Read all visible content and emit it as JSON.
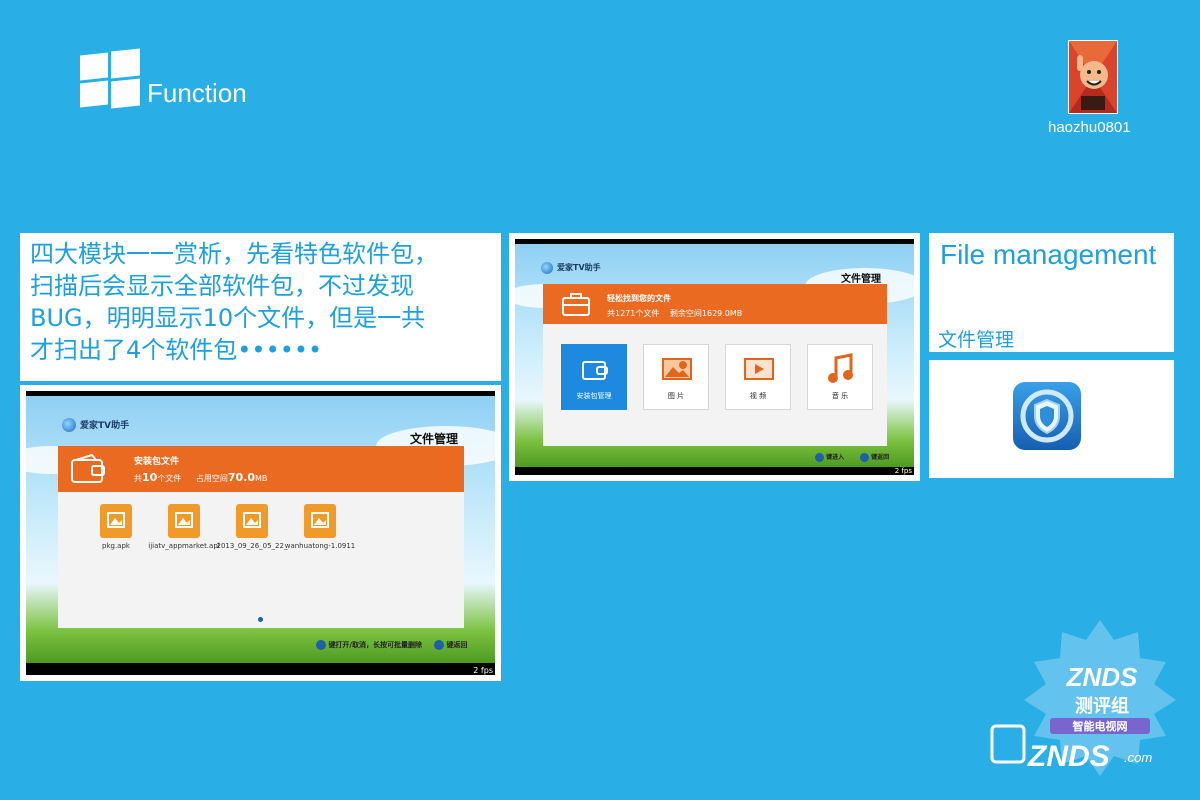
{
  "header": {
    "title": "Function",
    "user": "haozhu0801"
  },
  "description": {
    "lines": [
      "四大模块一一赏析，先看特色软件包，",
      "扫描后会显示全部软件包，不过发现",
      "BUG，明明显示10个文件，但是一共",
      "才扫出了4个软件包••••••"
    ]
  },
  "shot_home": {
    "app_name": "爱家TV助手",
    "page_title": "文件管理",
    "banner_title": "轻松找到您的文件",
    "total_label": "共1271个文件",
    "free_label": "剩余空间1629.0MB",
    "tiles": [
      {
        "label": "安装包管理",
        "icon": "wallet-icon"
      },
      {
        "label": "图 片",
        "icon": "picture-icon"
      },
      {
        "label": "视 频",
        "icon": "video-icon"
      },
      {
        "label": "音 乐",
        "icon": "music-icon"
      }
    ],
    "hint_ok": "键进入",
    "hint_back": "键返回",
    "fps": "2 fps"
  },
  "shot_apk": {
    "app_name": "爱家TV助手",
    "page_title": "文件管理",
    "banner_title": "安装包文件",
    "count_prefix": "共",
    "count_num": "10",
    "count_suffix": "个文件",
    "used_prefix": "占用空间",
    "used_num": "70.0",
    "used_unit": "MB",
    "files": [
      "pkg.apk",
      "ijiatv_appmarket.apl",
      "2013_09_26_05_22_",
      "wanhuatong-1.0911"
    ],
    "hint_ok": "键打开/取消，长按可批量删除",
    "hint_back": "键返回",
    "fps": "2 fps"
  },
  "file_mgmt": {
    "title": "File management",
    "subtitle": "文件管理"
  },
  "watermark": {
    "line1": "ZNDS",
    "line2": "测评组",
    "line3": "智能电视网",
    "site": "ZNDS",
    "domain": ".com"
  },
  "colors": {
    "background": "#29aee6",
    "accent_blue": "#1da0dc",
    "banner_orange": "#ea6a22"
  }
}
